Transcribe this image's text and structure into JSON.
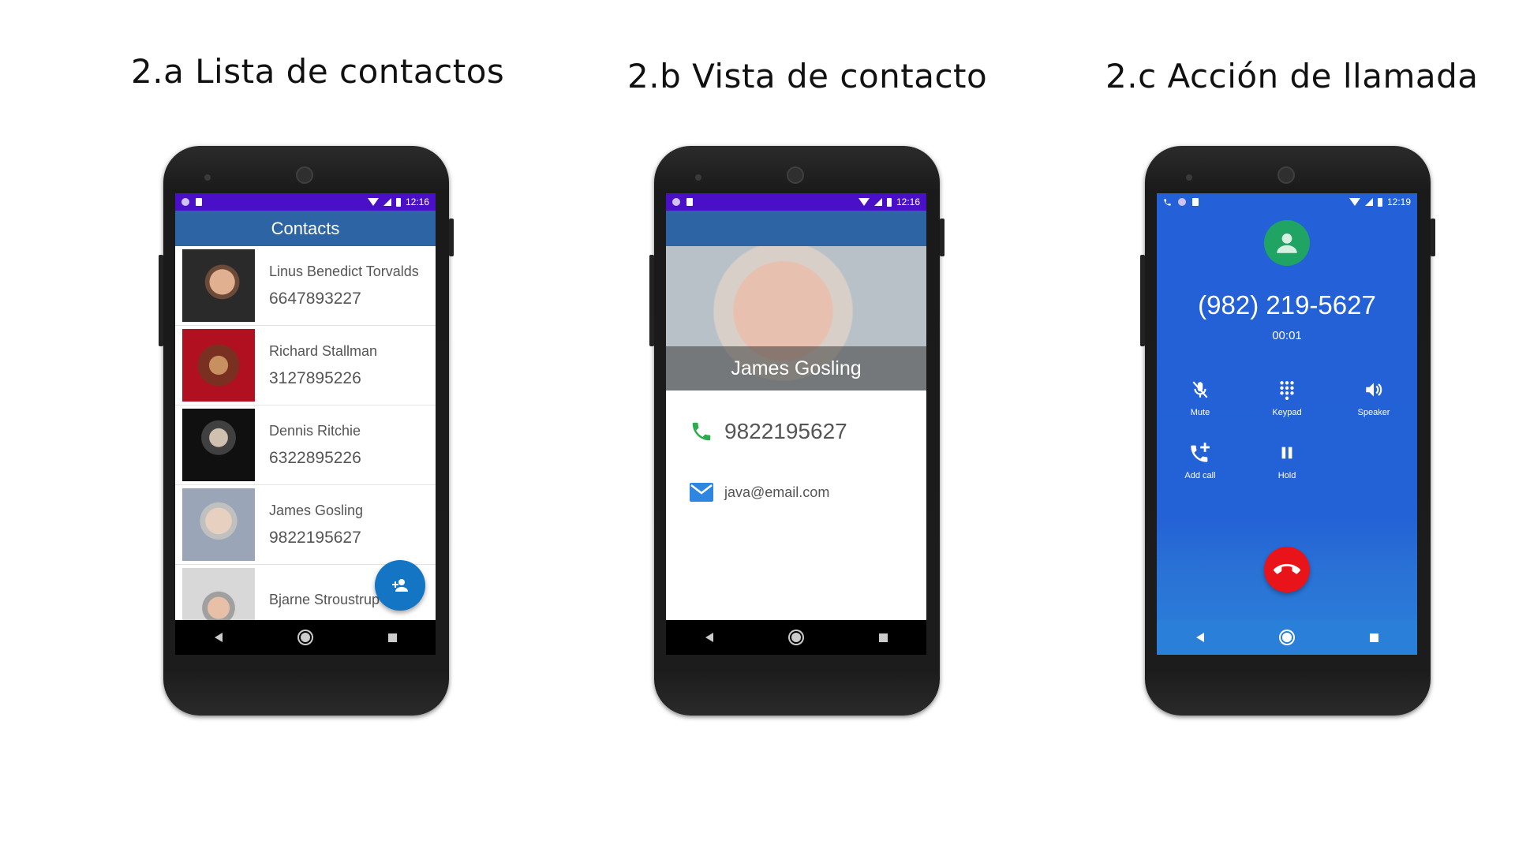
{
  "titles": {
    "panel_a": "2.a Lista de contactos",
    "panel_b": "2.b Vista de contacto",
    "panel_c": "2.c Acción de llamada"
  },
  "status": {
    "time_a": "12:16",
    "time_b": "12:16",
    "time_c": "12:19"
  },
  "contacts_screen": {
    "title": "Contacts",
    "contacts": [
      {
        "name": "Linus Benedict Torvalds",
        "phone": "6647893227"
      },
      {
        "name": "Richard Stallman",
        "phone": "3127895226"
      },
      {
        "name": "Dennis Ritchie",
        "phone": "6322895226"
      },
      {
        "name": "James Gosling",
        "phone": "9822195627"
      },
      {
        "name": "Bjarne Stroustrup",
        "phone": ""
      }
    ],
    "fab_icon": "add-person-icon"
  },
  "contact_detail": {
    "name": "James Gosling",
    "phone": "9822195627",
    "email": "java@email.com"
  },
  "call_screen": {
    "number": "(982) 219-5627",
    "timer": "00:01",
    "controls": {
      "mute": "Mute",
      "keypad": "Keypad",
      "speaker": "Speaker",
      "add_call": "Add call",
      "hold": "Hold"
    }
  },
  "colors": {
    "status_bar": "#4a10c8",
    "app_bar": "#2d64a3",
    "fab": "#1475c4",
    "call_bg": "#2461d8",
    "call_avatar": "#1fa463",
    "end_call": "#e8141a"
  }
}
